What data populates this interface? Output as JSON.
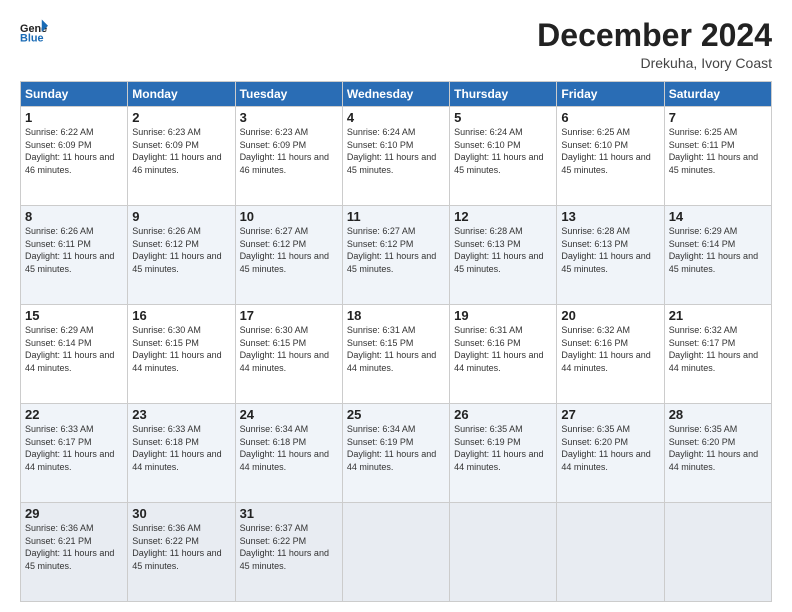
{
  "header": {
    "logo_line1": "General",
    "logo_line2": "Blue",
    "title": "December 2024",
    "subtitle": "Drekuha, Ivory Coast"
  },
  "weekdays": [
    "Sunday",
    "Monday",
    "Tuesday",
    "Wednesday",
    "Thursday",
    "Friday",
    "Saturday"
  ],
  "weeks": [
    [
      {
        "day": "1",
        "sunrise": "6:22 AM",
        "sunset": "6:09 PM",
        "daylight": "11 hours and 46 minutes."
      },
      {
        "day": "2",
        "sunrise": "6:23 AM",
        "sunset": "6:09 PM",
        "daylight": "11 hours and 46 minutes."
      },
      {
        "day": "3",
        "sunrise": "6:23 AM",
        "sunset": "6:09 PM",
        "daylight": "11 hours and 46 minutes."
      },
      {
        "day": "4",
        "sunrise": "6:24 AM",
        "sunset": "6:10 PM",
        "daylight": "11 hours and 45 minutes."
      },
      {
        "day": "5",
        "sunrise": "6:24 AM",
        "sunset": "6:10 PM",
        "daylight": "11 hours and 45 minutes."
      },
      {
        "day": "6",
        "sunrise": "6:25 AM",
        "sunset": "6:10 PM",
        "daylight": "11 hours and 45 minutes."
      },
      {
        "day": "7",
        "sunrise": "6:25 AM",
        "sunset": "6:11 PM",
        "daylight": "11 hours and 45 minutes."
      }
    ],
    [
      {
        "day": "8",
        "sunrise": "6:26 AM",
        "sunset": "6:11 PM",
        "daylight": "11 hours and 45 minutes."
      },
      {
        "day": "9",
        "sunrise": "6:26 AM",
        "sunset": "6:12 PM",
        "daylight": "11 hours and 45 minutes."
      },
      {
        "day": "10",
        "sunrise": "6:27 AM",
        "sunset": "6:12 PM",
        "daylight": "11 hours and 45 minutes."
      },
      {
        "day": "11",
        "sunrise": "6:27 AM",
        "sunset": "6:12 PM",
        "daylight": "11 hours and 45 minutes."
      },
      {
        "day": "12",
        "sunrise": "6:28 AM",
        "sunset": "6:13 PM",
        "daylight": "11 hours and 45 minutes."
      },
      {
        "day": "13",
        "sunrise": "6:28 AM",
        "sunset": "6:13 PM",
        "daylight": "11 hours and 45 minutes."
      },
      {
        "day": "14",
        "sunrise": "6:29 AM",
        "sunset": "6:14 PM",
        "daylight": "11 hours and 45 minutes."
      }
    ],
    [
      {
        "day": "15",
        "sunrise": "6:29 AM",
        "sunset": "6:14 PM",
        "daylight": "11 hours and 44 minutes."
      },
      {
        "day": "16",
        "sunrise": "6:30 AM",
        "sunset": "6:15 PM",
        "daylight": "11 hours and 44 minutes."
      },
      {
        "day": "17",
        "sunrise": "6:30 AM",
        "sunset": "6:15 PM",
        "daylight": "11 hours and 44 minutes."
      },
      {
        "day": "18",
        "sunrise": "6:31 AM",
        "sunset": "6:15 PM",
        "daylight": "11 hours and 44 minutes."
      },
      {
        "day": "19",
        "sunrise": "6:31 AM",
        "sunset": "6:16 PM",
        "daylight": "11 hours and 44 minutes."
      },
      {
        "day": "20",
        "sunrise": "6:32 AM",
        "sunset": "6:16 PM",
        "daylight": "11 hours and 44 minutes."
      },
      {
        "day": "21",
        "sunrise": "6:32 AM",
        "sunset": "6:17 PM",
        "daylight": "11 hours and 44 minutes."
      }
    ],
    [
      {
        "day": "22",
        "sunrise": "6:33 AM",
        "sunset": "6:17 PM",
        "daylight": "11 hours and 44 minutes."
      },
      {
        "day": "23",
        "sunrise": "6:33 AM",
        "sunset": "6:18 PM",
        "daylight": "11 hours and 44 minutes."
      },
      {
        "day": "24",
        "sunrise": "6:34 AM",
        "sunset": "6:18 PM",
        "daylight": "11 hours and 44 minutes."
      },
      {
        "day": "25",
        "sunrise": "6:34 AM",
        "sunset": "6:19 PM",
        "daylight": "11 hours and 44 minutes."
      },
      {
        "day": "26",
        "sunrise": "6:35 AM",
        "sunset": "6:19 PM",
        "daylight": "11 hours and 44 minutes."
      },
      {
        "day": "27",
        "sunrise": "6:35 AM",
        "sunset": "6:20 PM",
        "daylight": "11 hours and 44 minutes."
      },
      {
        "day": "28",
        "sunrise": "6:35 AM",
        "sunset": "6:20 PM",
        "daylight": "11 hours and 44 minutes."
      }
    ],
    [
      {
        "day": "29",
        "sunrise": "6:36 AM",
        "sunset": "6:21 PM",
        "daylight": "11 hours and 45 minutes."
      },
      {
        "day": "30",
        "sunrise": "6:36 AM",
        "sunset": "6:22 PM",
        "daylight": "11 hours and 45 minutes."
      },
      {
        "day": "31",
        "sunrise": "6:37 AM",
        "sunset": "6:22 PM",
        "daylight": "11 hours and 45 minutes."
      },
      null,
      null,
      null,
      null
    ]
  ]
}
